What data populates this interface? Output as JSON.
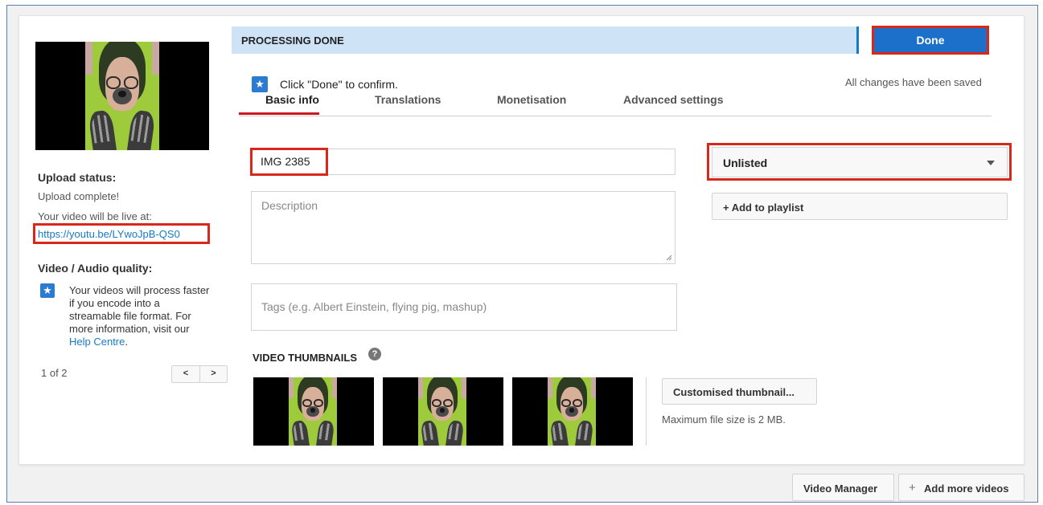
{
  "status": {
    "heading": "Upload status:",
    "complete": "Upload complete!",
    "live_label": "Your video will be live at:",
    "url": "https://youtu.be/LYwoJpB-QS0"
  },
  "quality": {
    "heading": "Video / Audio quality:",
    "tip_prefix": "Your videos will process faster if you encode into a streamable file format. For more information, visit our ",
    "tip_link": "Help Centre",
    "tip_suffix": ".",
    "pager": "1 of 2",
    "prev_label": "<",
    "next_label": ">"
  },
  "processing": {
    "banner": "PROCESSING DONE",
    "confirm": "Click \"Done\" to confirm.",
    "done_label": "Done",
    "saved": "All changes have been saved"
  },
  "tabs": [
    {
      "label": "Basic info",
      "active": true
    },
    {
      "label": "Translations",
      "active": false
    },
    {
      "label": "Monetisation",
      "active": false
    },
    {
      "label": "Advanced settings",
      "active": false
    }
  ],
  "form": {
    "title_value": "IMG 2385",
    "description_placeholder": "Description",
    "tags_placeholder": "Tags (e.g. Albert Einstein, flying pig, mashup)",
    "privacy_value": "Unlisted",
    "add_playlist": "+ Add to playlist"
  },
  "thumbnails": {
    "heading": "VIDEO THUMBNAILS",
    "custom_button": "Customised thumbnail...",
    "max_size": "Maximum file size is 2 MB."
  },
  "footer": {
    "video_manager": "Video Manager",
    "add_more": "Add more videos",
    "plus": "+"
  },
  "colors": {
    "accent_blue": "#1d70c9",
    "highlight_red": "#d7281a",
    "banner_blue": "#cfe3f7",
    "tab_red": "#cc181e"
  },
  "icons": [
    "star-icon",
    "help-circle-icon",
    "caret-down-icon",
    "plus-icon"
  ]
}
